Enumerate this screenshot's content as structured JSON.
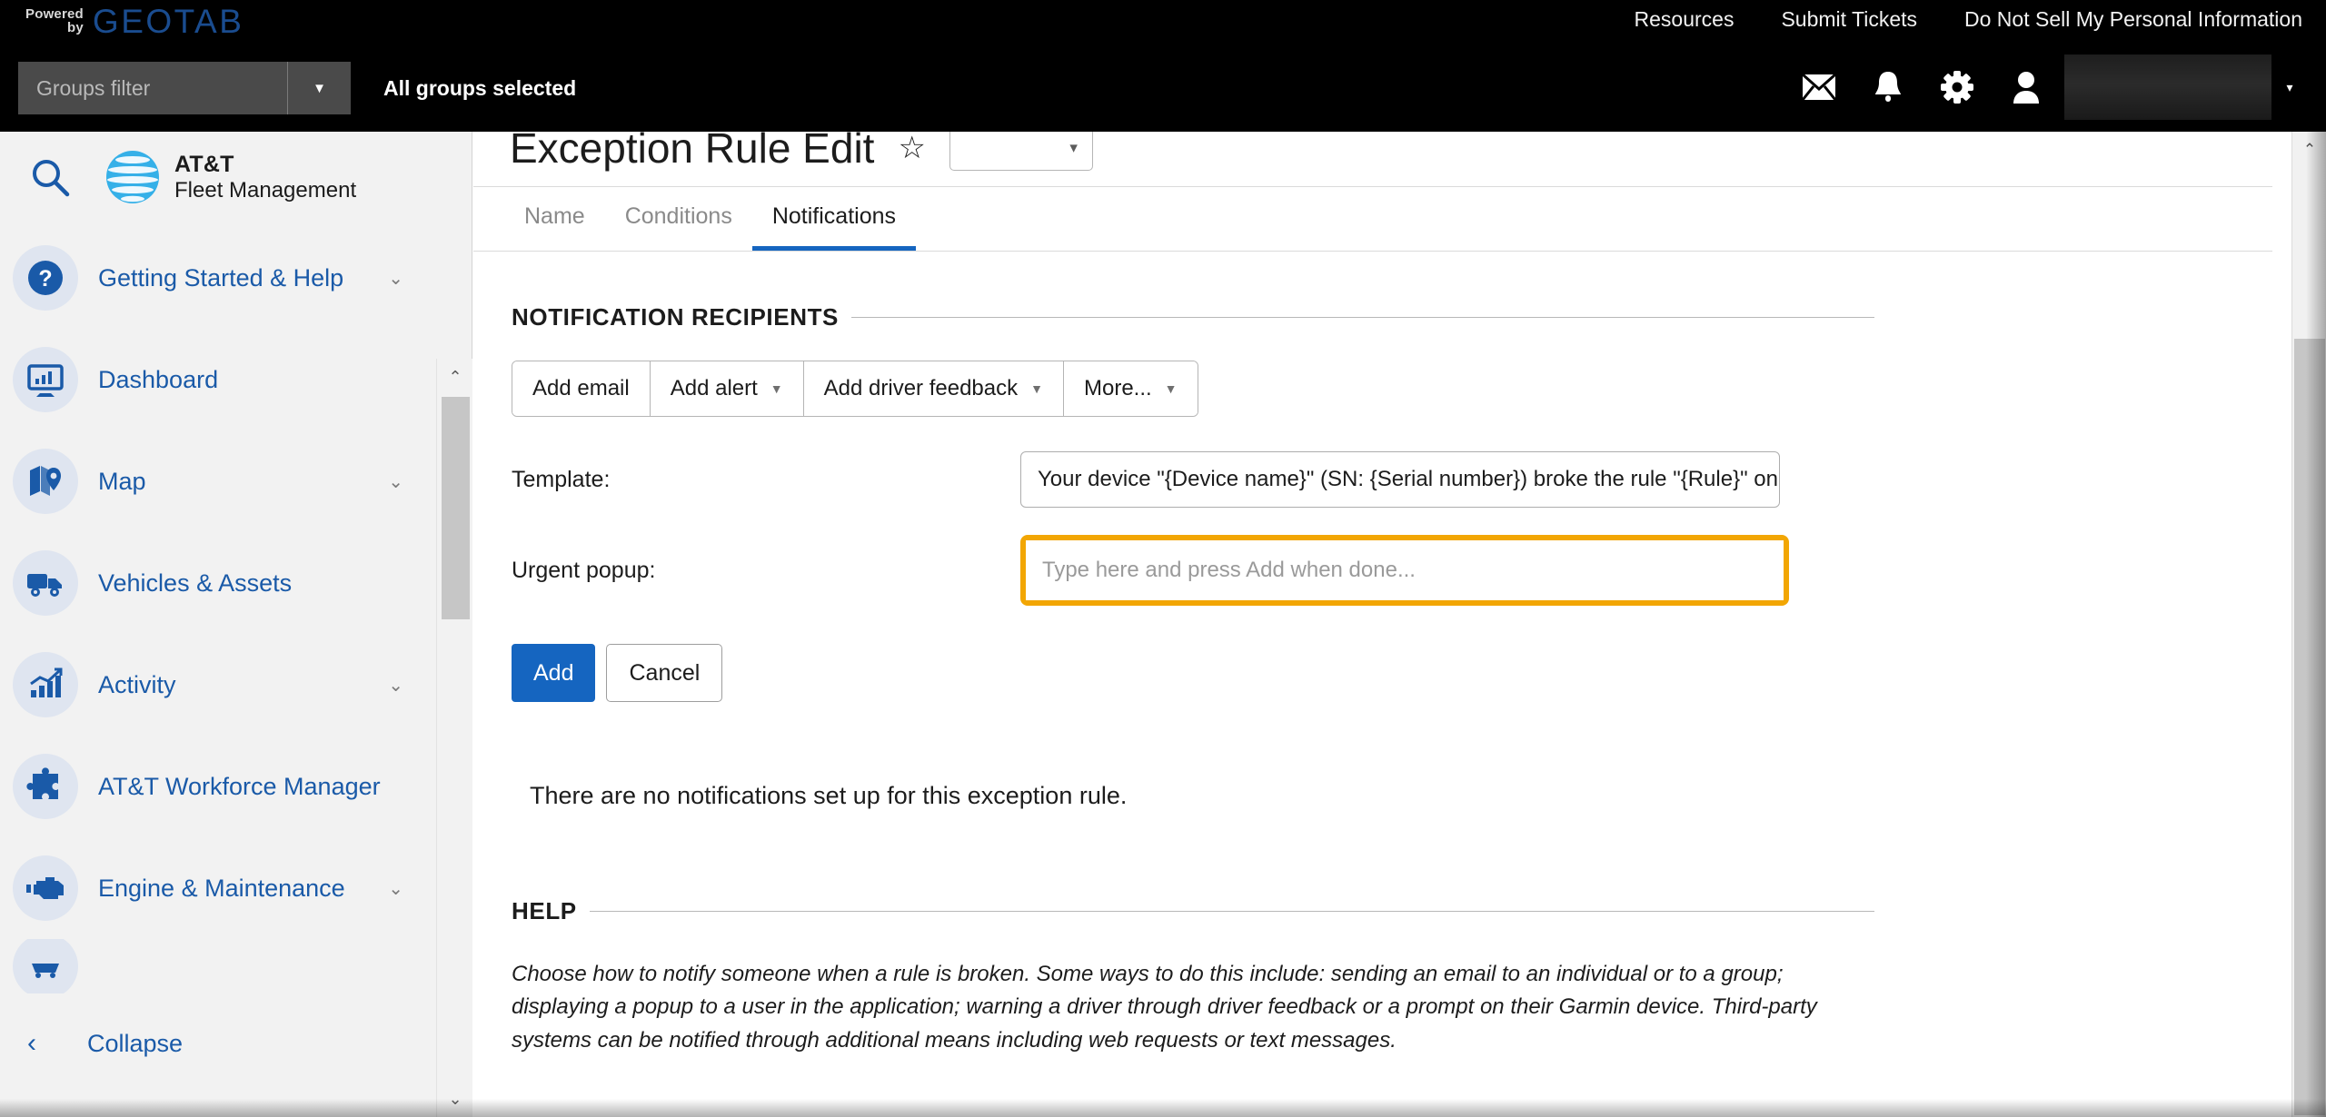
{
  "topbar": {
    "powered": "Powered",
    "by": "by",
    "brand": "GEOTAB",
    "links": [
      {
        "label": "Resources"
      },
      {
        "label": "Submit Tickets"
      },
      {
        "label": "Do Not Sell My Personal Information"
      }
    ],
    "groups_filter_placeholder": "Groups filter",
    "groups_selected": "All groups selected",
    "icons": {
      "mail": "mail-icon",
      "bell": "bell-icon",
      "gear": "gear-icon",
      "user": "user-icon",
      "caret": "▾"
    }
  },
  "sidebar": {
    "search_icon": "search-icon",
    "logo_line1": "AT&T",
    "logo_line2": "Fleet Management",
    "items": [
      {
        "label": "Getting Started & Help",
        "icon": "question-circle-icon",
        "expandable": true
      },
      {
        "label": "Dashboard",
        "icon": "dashboard-monitor-icon",
        "expandable": false
      },
      {
        "label": "Map",
        "icon": "map-pin-icon",
        "expandable": true
      },
      {
        "label": "Vehicles & Assets",
        "icon": "truck-icon",
        "expandable": false
      },
      {
        "label": "Activity",
        "icon": "bar-chart-icon",
        "expandable": true
      },
      {
        "label": "AT&T Workforce Manager",
        "icon": "puzzle-piece-icon",
        "expandable": false
      },
      {
        "label": "Engine & Maintenance",
        "icon": "engine-icon",
        "expandable": true
      }
    ],
    "collapse_label": "Collapse",
    "collapse_icon": "chevron-left-icon"
  },
  "main": {
    "page_title": "Exception Rule Edit",
    "favorite_icon": "☆",
    "title_button_caret": "▾",
    "tabs": [
      {
        "label": "Name",
        "active": false
      },
      {
        "label": "Conditions",
        "active": false
      },
      {
        "label": "Notifications",
        "active": true
      }
    ],
    "recipients": {
      "legend": "NOTIFICATION RECIPIENTS",
      "buttons": [
        {
          "label": "Add email",
          "has_caret": false
        },
        {
          "label": "Add alert",
          "has_caret": true
        },
        {
          "label": "Add driver feedback",
          "has_caret": true
        },
        {
          "label": "More...",
          "has_caret": true
        }
      ]
    },
    "template": {
      "label": "Template:",
      "value": "Your device \"{Device name}\" (SN: {Serial number}) broke the rule \"{Rule}\" on ·"
    },
    "urgent_popup": {
      "label": "Urgent popup:",
      "placeholder": "Type here and press Add when done...",
      "value": "",
      "highlight_color": "#f2a603"
    },
    "actions": {
      "add_label": "Add",
      "cancel_label": "Cancel",
      "primary_color": "#1565c0"
    },
    "empty_state": "There are no notifications set up for this exception rule.",
    "help": {
      "legend": "HELP",
      "text": "Choose how to notify someone when a rule is broken. Some ways to do this include: sending an email to an individual or to a group; displaying a popup to a user in the application; warning a driver through driver feedback or a prompt on their Garmin device. Third-party systems can be notified through additional means including web requests or text messages."
    }
  },
  "scrollbars": {
    "up_arrow": "⌃",
    "down_arrow": "⌄"
  }
}
